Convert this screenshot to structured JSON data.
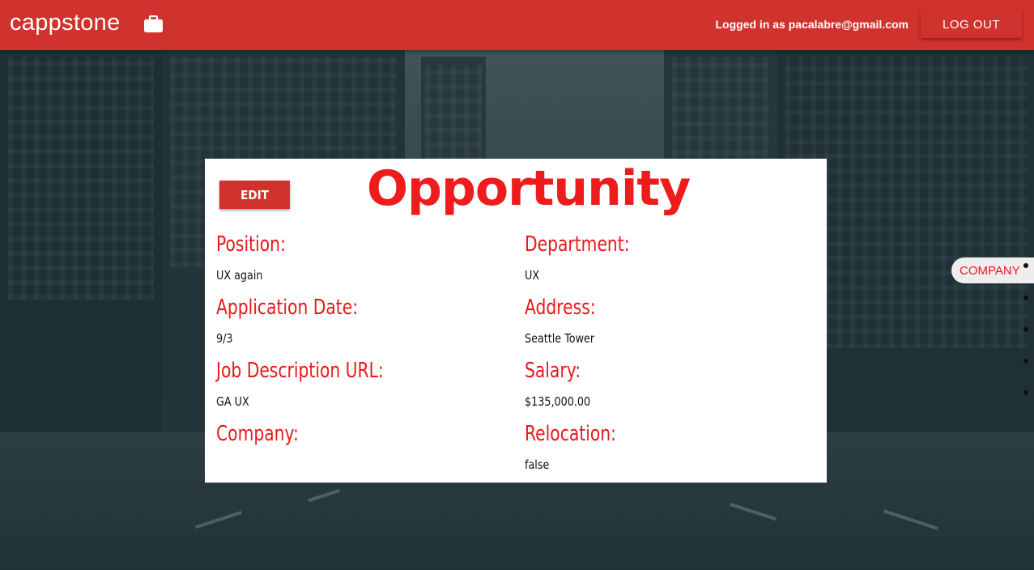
{
  "header": {
    "brand": "cappstone",
    "brand_icon": "briefcase-icon",
    "login_prefix": "Logged in as ",
    "login_email": "pacalabre@gmail.com",
    "logout_label": "LOG OUT",
    "color": "#d0322d"
  },
  "card": {
    "edit_label": "EDIT",
    "title": "Opportunity",
    "fields": [
      {
        "label": "Position:",
        "value": "UX again"
      },
      {
        "label": "Department:",
        "value": "UX"
      },
      {
        "label": "Application Date:",
        "value": "9/3"
      },
      {
        "label": "Address:",
        "value": "Seattle Tower"
      },
      {
        "label": "Job Description URL:",
        "value": "GA UX"
      },
      {
        "label": "Salary:",
        "value": "$135,000.00"
      },
      {
        "label": "Company:",
        "value": ""
      },
      {
        "label": "Relocation:",
        "value": "false"
      }
    ]
  },
  "side_nav": {
    "active_label": "COMPANY",
    "dot_count": 5
  }
}
